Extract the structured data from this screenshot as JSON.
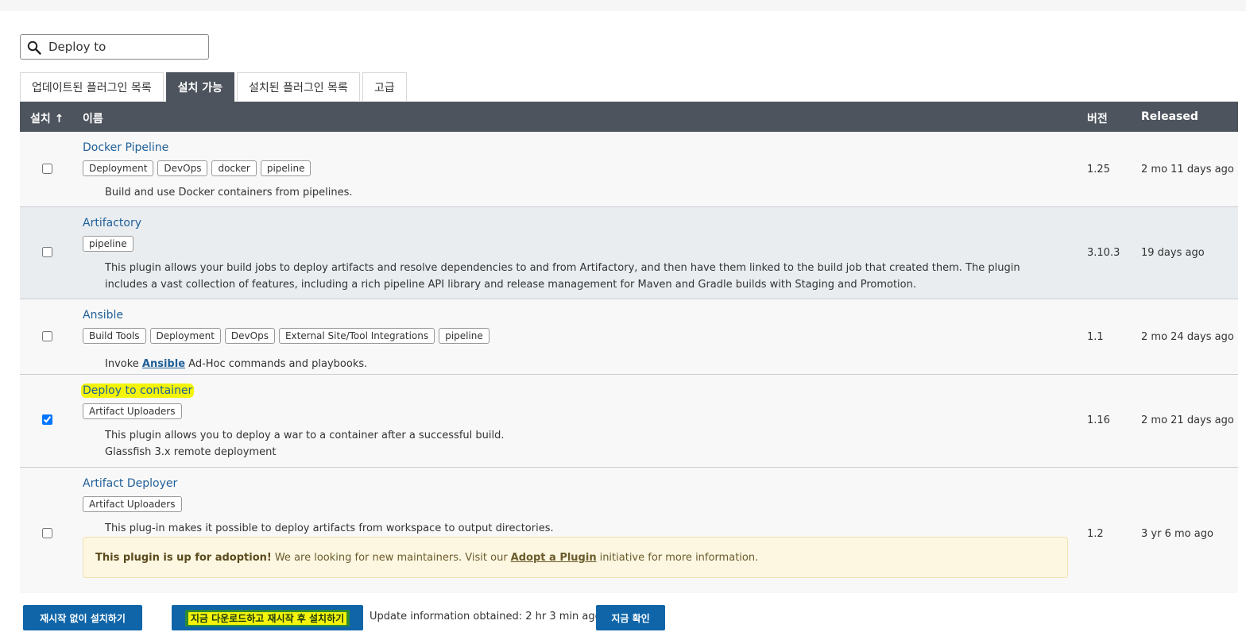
{
  "search": {
    "value": "Deploy to"
  },
  "tabs": [
    {
      "label": "업데이트된 플러그인 목록",
      "active": false
    },
    {
      "label": "설치 가능",
      "active": true
    },
    {
      "label": "설치된 플러그인 목록",
      "active": false
    },
    {
      "label": "고급",
      "active": false
    }
  ],
  "table": {
    "headers": {
      "install": "설치 ↑",
      "name": "이름",
      "version": "버전",
      "released": "Released"
    },
    "rows": [
      {
        "name": "Docker Pipeline",
        "labels": [
          "Deployment",
          "DevOps",
          "docker",
          "pipeline"
        ],
        "description": "Build and use Docker containers from pipelines.",
        "version": "1.25",
        "released": "2 mo 11 days ago",
        "checked": false
      },
      {
        "name": "Artifactory",
        "labels": [
          "pipeline"
        ],
        "description": "This plugin allows your build jobs to deploy artifacts and resolve dependencies to and from Artifactory, and then have them linked to the build job that created them. The plugin includes a vast collection of features, including a rich pipeline API library and release management for Maven and Gradle builds with Staging and Promotion.",
        "version": "3.10.3",
        "released": "19 days ago",
        "checked": false
      },
      {
        "name": "Ansible",
        "labels": [
          "Build Tools",
          "Deployment",
          "DevOps",
          "External Site/Tool Integrations",
          "pipeline"
        ],
        "description_prefix": "Invoke ",
        "description_link": "Ansible",
        "description_suffix": " Ad-Hoc commands and playbooks.",
        "version": "1.1",
        "released": "2 mo 24 days ago",
        "checked": false
      },
      {
        "name": "Deploy to container",
        "labels": [
          "Artifact Uploaders"
        ],
        "description": "This plugin allows you to deploy a war to a container after a successful build.",
        "description_line2": "Glassfish 3.x remote deployment",
        "version": "1.16",
        "released": "2 mo 21 days ago",
        "checked": true
      },
      {
        "name": "Artifact Deployer",
        "labels": [
          "Artifact Uploaders"
        ],
        "description": "This plug-in makes it possible to deploy artifacts from workspace to output directories.",
        "adoption": {
          "bold": "This plugin is up for adoption!",
          "text1": "We are looking for new maintainers. Visit our",
          "link": "Adopt a Plugin",
          "text2": "initiative for more information."
        },
        "version": "1.2",
        "released": "3 yr 6 mo ago",
        "checked": false
      }
    ]
  },
  "footer": {
    "install_without_restart": "재시작 없이 설치하기",
    "download_install_after_restart": "지금 다운로드하고 재시작 후 설치하기",
    "update_info": "Update information obtained: 2 hr 3 min ago",
    "check_now": "지금 확인"
  },
  "colors": {
    "header_bg": "#4d545d",
    "link": "#1f5f98",
    "button": "#0f65a8",
    "highlight": "#f4f40a"
  }
}
